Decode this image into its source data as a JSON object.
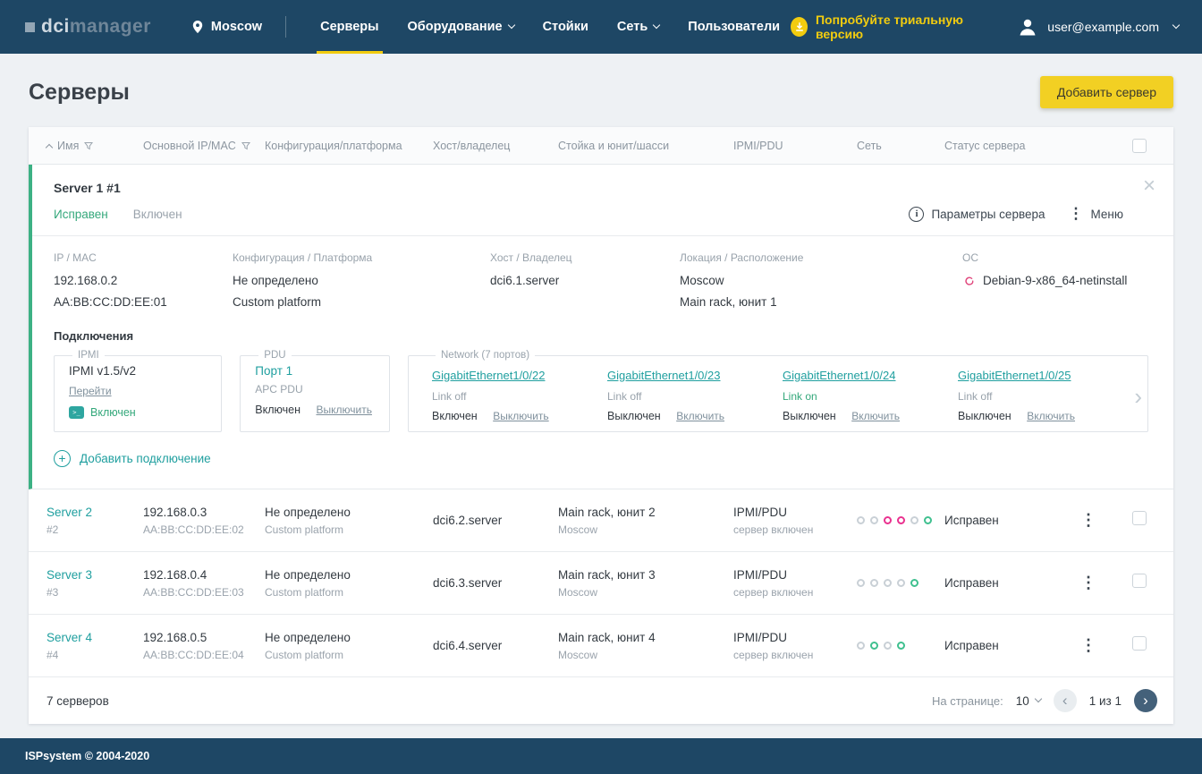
{
  "navbar": {
    "logo_prefix": "dci",
    "logo_suffix": "manager",
    "location": "Moscow",
    "items": [
      {
        "label": "Серверы"
      },
      {
        "label": "Оборудование"
      },
      {
        "label": "Стойки"
      },
      {
        "label": "Сеть"
      },
      {
        "label": "Пользователи"
      }
    ],
    "trial": "Попробуйте триальную версию",
    "user_email": "user@example.com"
  },
  "page": {
    "title": "Серверы",
    "add_button": "Добавить сервер"
  },
  "table": {
    "headers": [
      "Имя",
      "Основной IP/MAC",
      "Конфигурация/платформа",
      "Хост/владелец",
      "Стойка и юнит/шасси",
      "IPMI/PDU",
      "Сеть",
      "Статус сервера"
    ],
    "expanded": {
      "name": "Server 1 #1",
      "status": "Исправен",
      "power": "Включен",
      "params_label": "Параметры сервера",
      "menu_label": "Меню",
      "details": [
        {
          "label": "IP / MAC",
          "line1": "192.168.0.2",
          "line2": "AA:BB:CC:DD:EE:01"
        },
        {
          "label": "Конфигурация / Платформа",
          "line1": "Не определено",
          "line2": "Custom platform"
        },
        {
          "label": "Хост / Владелец",
          "line1": "dci6.1.server",
          "line2": ""
        },
        {
          "label": "Локация / Расположение",
          "line1": "Moscow",
          "line2": "Main rack, юнит 1"
        },
        {
          "label": "ОС",
          "line1": "Debian-9-x86_64-netinstall",
          "line2": ""
        }
      ],
      "connections_title": "Подключения",
      "ipmi": {
        "legend": "IPMI",
        "title": "IPMI v1.5/v2",
        "link": "Перейти",
        "status": "Включен"
      },
      "pdu": {
        "legend": "PDU",
        "title": "Порт 1",
        "subtitle": "APC PDU",
        "state": "Включен",
        "action": "Выключить"
      },
      "network": {
        "legend": "Network (7 портов)",
        "ports": [
          {
            "name": "GigabitEthernet1/0/22",
            "link": "Link off",
            "state": "Включен",
            "action": "Выключить"
          },
          {
            "name": "GigabitEthernet1/0/23",
            "link": "Link off",
            "state": "Выключен",
            "action": "Включить"
          },
          {
            "name": "GigabitEthernet1/0/24",
            "link": "Link on",
            "state": "Выключен",
            "action": "Включить"
          },
          {
            "name": "GigabitEthernet1/0/25",
            "link": "Link off",
            "state": "Выключен",
            "action": "Включить"
          }
        ]
      },
      "add_connection": "Добавить подключение"
    },
    "rows": [
      {
        "name": "Server 2",
        "id": "#2",
        "ip": "192.168.0.3",
        "mac": "AA:BB:CC:DD:EE:02",
        "config": "Не определено",
        "platform": "Custom platform",
        "host": "dci6.2.server",
        "rack": "Main rack, юнит 2",
        "location": "Moscow",
        "ipmi": "IPMI/PDU",
        "ipmi_sub": "сервер включен",
        "dots": [
          "off",
          "off",
          "link",
          "link",
          "off",
          "on"
        ],
        "status": "Исправен"
      },
      {
        "name": "Server 3",
        "id": "#3",
        "ip": "192.168.0.4",
        "mac": "AA:BB:CC:DD:EE:03",
        "config": "Не определено",
        "platform": "Custom platform",
        "host": "dci6.3.server",
        "rack": "Main rack, юнит 3",
        "location": "Moscow",
        "ipmi": "IPMI/PDU",
        "ipmi_sub": "сервер включен",
        "dots": [
          "off",
          "off",
          "off",
          "off",
          "on"
        ],
        "status": "Исправен"
      },
      {
        "name": "Server 4",
        "id": "#4",
        "ip": "192.168.0.5",
        "mac": "AA:BB:CC:DD:EE:04",
        "config": "Не определено",
        "platform": "Custom platform",
        "host": "dci6.4.server",
        "rack": "Main rack, юнит 4",
        "location": "Moscow",
        "ipmi": "IPMI/PDU",
        "ipmi_sub": "сервер включен",
        "dots": [
          "off",
          "on",
          "off",
          "on"
        ],
        "status": "Исправен"
      }
    ],
    "footer": {
      "total": "7 серверов",
      "per_page_label": "На странице:",
      "per_page": "10",
      "pagination": "1 из 1"
    }
  },
  "footer": {
    "copyright": "ISPsystem © 2004-2020"
  },
  "icons": {
    "close": "×",
    "kebab": "⋮",
    "chevron_right": "›",
    "page_prev": "‹",
    "page_next": "›",
    "plus": "+",
    "info": "i",
    "terminal": ">_"
  },
  "colors": {
    "navy": "#1e4765",
    "accent_yellow": "#f2cc0f",
    "teal": "#1f9f9f",
    "green": "#34a87b",
    "pink": "#e9318f"
  }
}
